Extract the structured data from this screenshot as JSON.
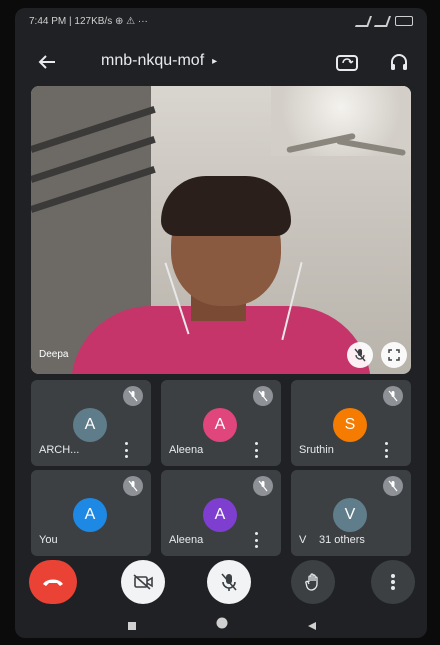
{
  "status_bar": {
    "time_text": "7:44 PM | 127KB/s ⊕ ⚠ ···"
  },
  "meeting": {
    "code": "mnb-nkqu-mof",
    "dropdown_glyph": "▸"
  },
  "main_video": {
    "speaker_name": "Deepa"
  },
  "participants": [
    {
      "initial": "A",
      "name": "ARCH...",
      "color": "#5f7c8a"
    },
    {
      "initial": "A",
      "name": "Aleena",
      "color": "#e0457b"
    },
    {
      "initial": "S",
      "name": "Sruthin",
      "color": "#f57c00"
    },
    {
      "initial": "A",
      "name": "You",
      "color": "#1e88e5"
    },
    {
      "initial": "A",
      "name": "Aleena",
      "color": "#7e3fd1"
    },
    {
      "initial": "V",
      "name": "V",
      "color": "#607d8b",
      "others_text": "31 others"
    }
  ],
  "controls": {
    "end_call_color": "#ea4335",
    "icons": [
      "end-call-icon",
      "video-off-icon",
      "mic-off-icon",
      "raise-hand-icon",
      "more-options-icon"
    ]
  },
  "colors": {
    "tile_bg": "#3c4043",
    "app_bg": "#202124"
  }
}
